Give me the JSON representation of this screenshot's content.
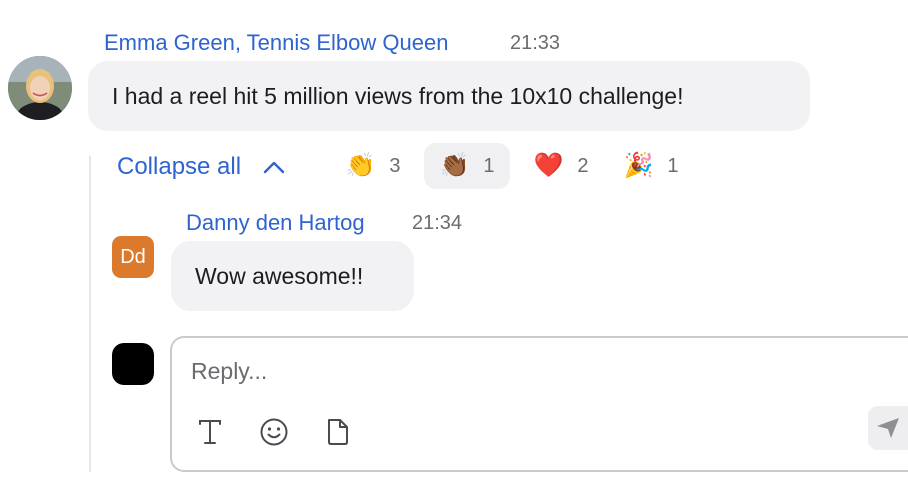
{
  "parent_message": {
    "author": "Emma Green, Tennis Elbow Queen",
    "time": "21:33",
    "text": "I had a reel hit 5 million views from the 10x10 challenge!",
    "avatar_icon": "user-photo"
  },
  "thread": {
    "collapse_label": "Collapse all",
    "collapse_icon": "chevron-up-icon"
  },
  "reactions": [
    {
      "emoji": "👏",
      "count": "3",
      "icon": "clapping-hands-icon",
      "active": false
    },
    {
      "emoji": "👏🏾",
      "count": "1",
      "icon": "clapping-hands-dark-icon",
      "active": true
    },
    {
      "emoji": "❤️",
      "count": "2",
      "icon": "red-heart-icon",
      "active": false
    },
    {
      "emoji": "🎉",
      "count": "1",
      "icon": "party-popper-icon",
      "active": false
    }
  ],
  "reply_message": {
    "author": "Danny den Hartog",
    "time": "21:34",
    "avatar_initials": "Dd",
    "text": "Wow awesome!!"
  },
  "composer": {
    "placeholder": "Reply...",
    "tools": [
      "text-format-icon",
      "emoji-icon",
      "file-icon"
    ],
    "send_icon": "send-icon"
  },
  "colors": {
    "accent": "#2f63d0",
    "bubble": "#f2f2f5",
    "initials_avatar": "#db7a2c"
  }
}
